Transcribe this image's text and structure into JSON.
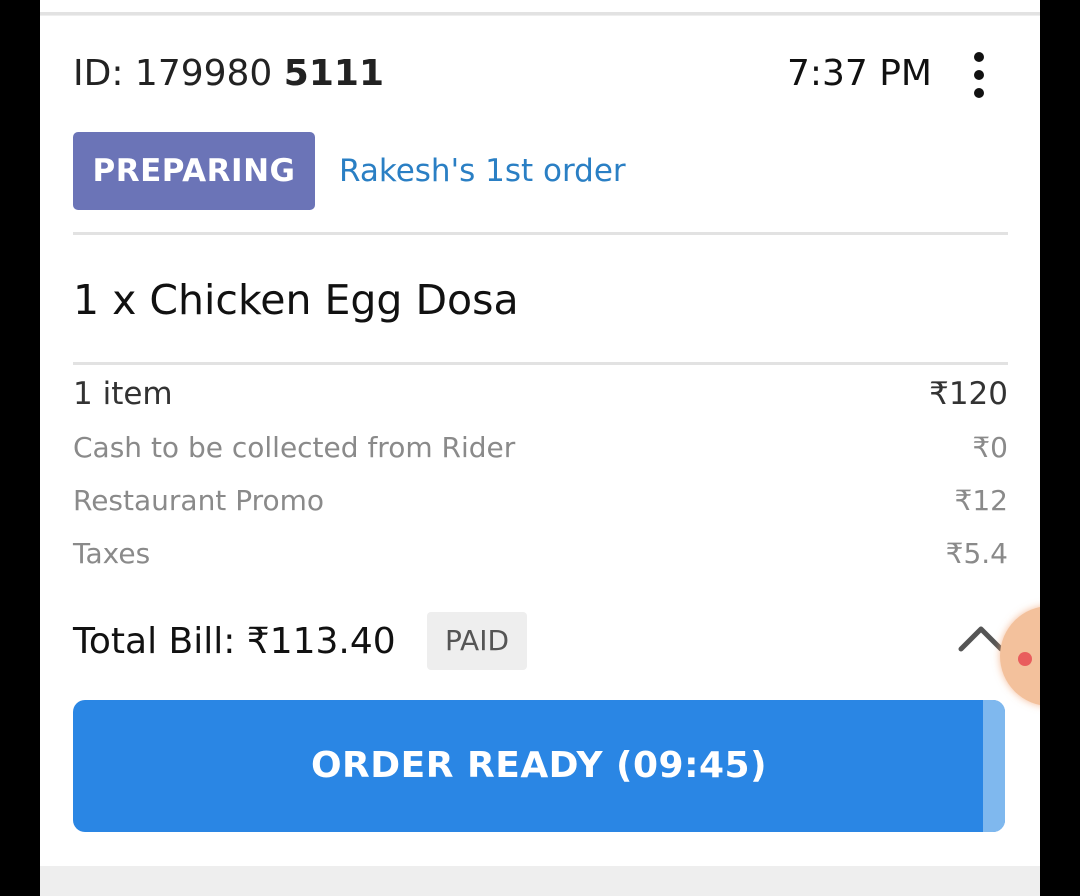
{
  "order": {
    "id_label": "ID: 179980",
    "id_suffix": "5111",
    "time": "7:37 PM",
    "status": "PREPARING",
    "customer_note": "Rakesh's 1st order",
    "item_line": "1 x Chicken Egg Dosa"
  },
  "bill": {
    "rows": [
      {
        "label": "1 item",
        "value": "₹120"
      },
      {
        "label": "Cash to be collected from Rider",
        "value": "₹0"
      },
      {
        "label": "Restaurant Promo",
        "value": "₹12"
      },
      {
        "label": "Taxes",
        "value": "₹5.4"
      }
    ],
    "total_label": "Total Bill: ₹113.40",
    "payment_status": "PAID"
  },
  "actions": {
    "order_ready_label": "ORDER READY (09:45)"
  },
  "icons": {
    "menu": "kebab-menu-icon",
    "collapse": "chevron-up-icon"
  },
  "colors": {
    "status_badge": "#6b74b7",
    "customer_note": "#2a7fc4",
    "primary_button": "#2a86e4"
  }
}
